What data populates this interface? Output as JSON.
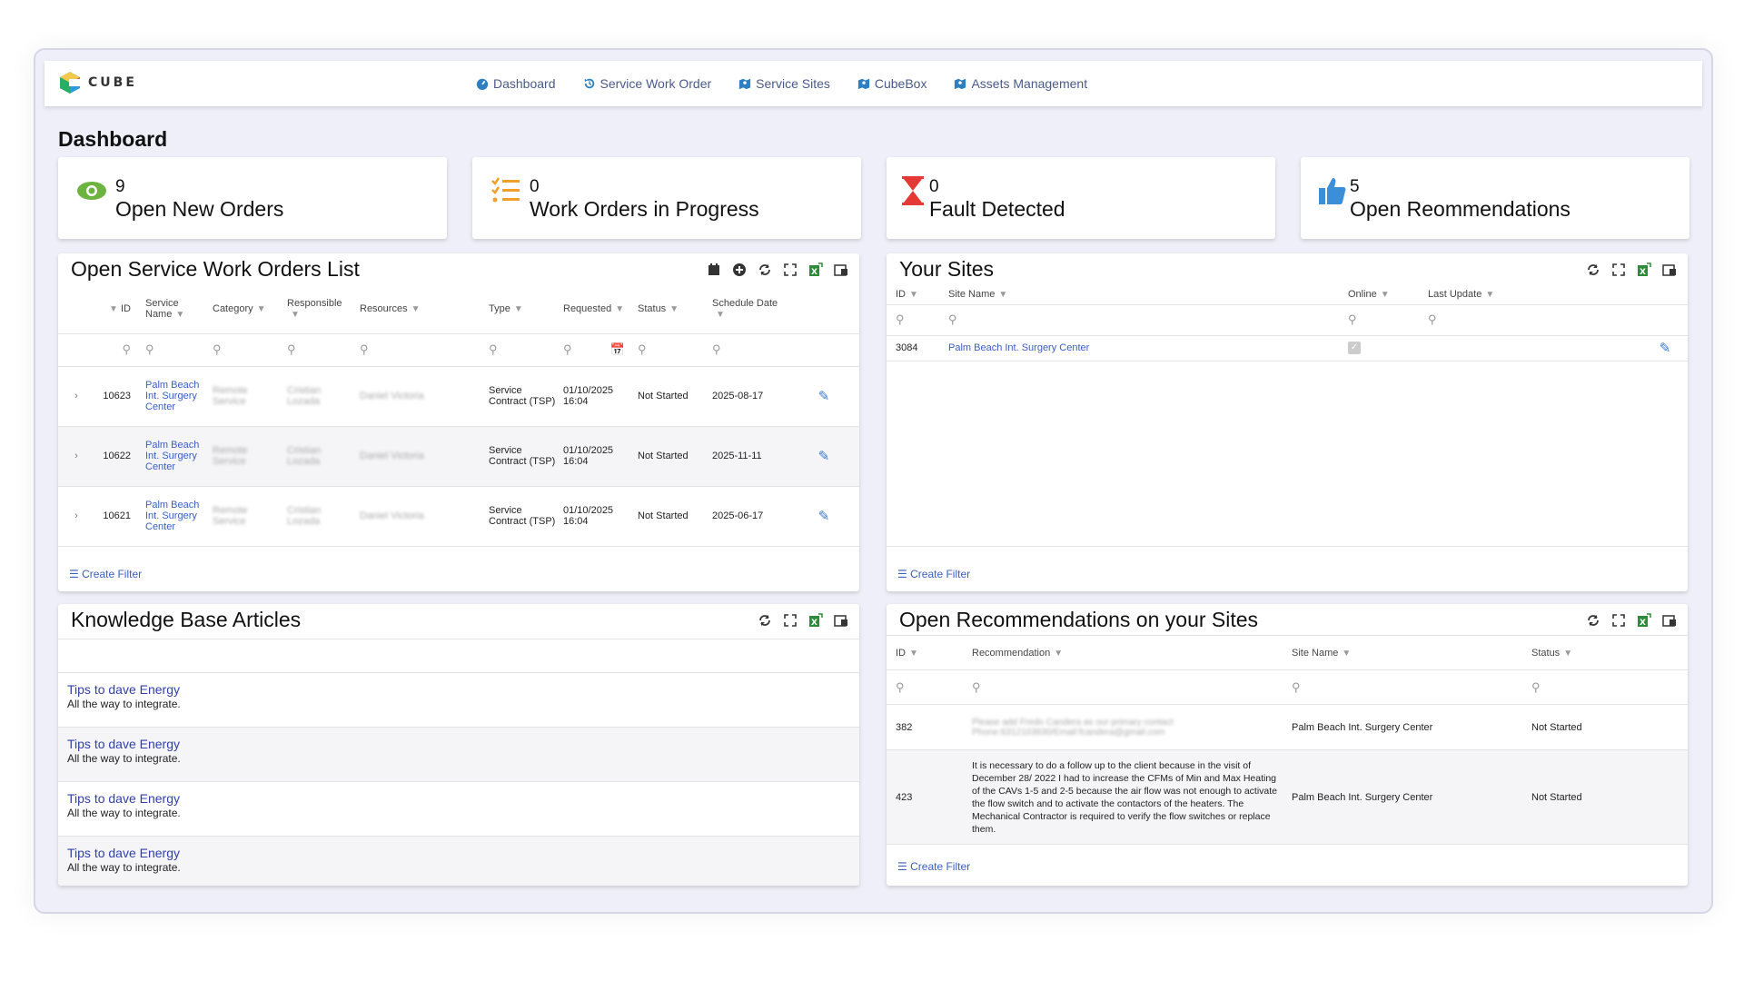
{
  "nav": {
    "brand": "CUBE",
    "items": [
      {
        "label": "Dashboard",
        "icon": "dashboard-icon"
      },
      {
        "label": "Service Work Order",
        "icon": "history-icon"
      },
      {
        "label": "Service Sites",
        "icon": "map-icon"
      },
      {
        "label": "CubeBox",
        "icon": "map-icon"
      },
      {
        "label": "Assets Management",
        "icon": "map-icon"
      }
    ]
  },
  "page_title": "Dashboard",
  "cards": [
    {
      "count": "9",
      "label": "Open New Orders",
      "icon": "eye-icon",
      "color": "#6db33f"
    },
    {
      "count": "0",
      "label": "Work Orders in Progress",
      "icon": "checklist-icon",
      "color": "#f0a028"
    },
    {
      "count": "0",
      "label": "Fault Detected",
      "icon": "hourglass-icon",
      "color": "#e53935"
    },
    {
      "count": "5",
      "label": "Open Reommendations",
      "icon": "thumbs-up-icon",
      "color": "#3b8fd9"
    }
  ],
  "work_orders": {
    "title": "Open Service Work Orders List",
    "columns": [
      "ID",
      "Service Name",
      "Category",
      "Responsible",
      "Resources",
      "Type",
      "Requested",
      "Status",
      "Schedule Date"
    ],
    "rows": [
      {
        "id": "10623",
        "service": "Palm Beach Int. Surgery Center",
        "category": "Remote Service",
        "responsible": "Cristian Lozada",
        "resources": "Daniel Victoria",
        "type": "Service Contract (TSP)",
        "requested": "01/10/2025 16:04",
        "status": "Not Started",
        "schedule": "2025-08-17"
      },
      {
        "id": "10622",
        "service": "Palm Beach Int. Surgery Center",
        "category": "Remote Service",
        "responsible": "Cristian Lozada",
        "resources": "Daniel Victoria",
        "type": "Service Contract (TSP)",
        "requested": "01/10/2025 16:04",
        "status": "Not Started",
        "schedule": "2025-11-11"
      },
      {
        "id": "10621",
        "service": "Palm Beach Int. Surgery Center",
        "category": "Remote Service",
        "responsible": "Cristian Lozada",
        "resources": "Daniel Victoria",
        "type": "Service Contract (TSP)",
        "requested": "01/10/2025 16:04",
        "status": "Not Started",
        "schedule": "2025-06-17"
      }
    ],
    "create_filter": "Create Filter"
  },
  "sites": {
    "title": "Your Sites",
    "columns": [
      "ID",
      "Site Name",
      "Online",
      "Last Update"
    ],
    "rows": [
      {
        "id": "3084",
        "name": "Palm Beach Int. Surgery Center",
        "online": true,
        "last_update": ""
      }
    ],
    "create_filter": "Create Filter"
  },
  "kb": {
    "title": "Knowledge Base Articles",
    "items": [
      {
        "title": "Tips to dave Energy",
        "desc": "All the way to integrate."
      },
      {
        "title": "Tips to dave Energy",
        "desc": "All the way to integrate."
      },
      {
        "title": "Tips to dave Energy",
        "desc": "All the way to integrate."
      },
      {
        "title": "Tips to dave Energy",
        "desc": "All the way to integrate."
      }
    ]
  },
  "recs": {
    "title": "Open Recommendations on your Sites",
    "columns": [
      "ID",
      "Recommendation",
      "Site Name",
      "Status"
    ],
    "rows": [
      {
        "id": "382",
        "text": "Please add Fredo Candera as our primary contact Phone:6312103930/Email:fcandera@gmail.com",
        "blurred": true,
        "site": "Palm Beach Int. Surgery Center",
        "status": "Not Started"
      },
      {
        "id": "423",
        "text": "It is necessary to do a follow up to the client because in the visit of December 28/ 2022 I had to increase the CFMs of Min and Max Heating of the CAVs 1-5 and 2-5 because the air flow was not enough to activate the flow switch and to activate the contactors of the heaters. The Mechanical Contractor is required to verify the flow switches or replace them.",
        "blurred": false,
        "site": "Palm Beach Int. Surgery Center",
        "status": "Not Started"
      }
    ],
    "create_filter": "Create Filter"
  }
}
